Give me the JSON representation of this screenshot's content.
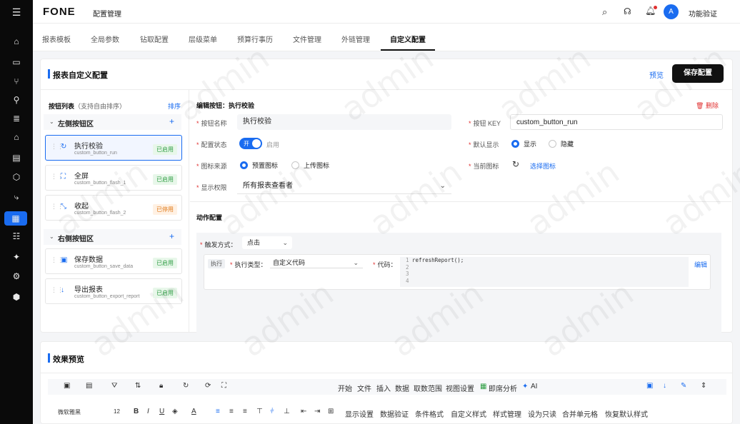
{
  "brand": {
    "logo": "FONE",
    "section": "配置管理"
  },
  "header": {
    "user_avatar": "A",
    "user_name": "功能验证"
  },
  "tabs": [
    "报表模板",
    "全局参数",
    "钻取配置",
    "层级菜单",
    "预算行事历",
    "文件管理",
    "外链管理",
    "自定义配置"
  ],
  "panel": {
    "title": "报表自定义配置",
    "preview_link": "预览",
    "save_button": "保存配置"
  },
  "button_list": {
    "title": "按钮列表",
    "hint": "（支持自由排序）",
    "sort_link": "排序",
    "groups": [
      {
        "name": "左侧按钮区",
        "add": "+",
        "items": [
          {
            "label": "执行校验",
            "key": "custom_button_run",
            "status": "已启用",
            "icon": "refresh-icon"
          },
          {
            "label": "全屏",
            "key": "custom_button_flash_1",
            "status": "已启用",
            "icon": "expand-icon"
          },
          {
            "label": "收起",
            "key": "custom_button_flash_2",
            "status": "已停用",
            "icon": "collapse-icon"
          }
        ]
      },
      {
        "name": "右侧按钮区",
        "add": "+",
        "items": [
          {
            "label": "保存数据",
            "key": "custom_button_save_data",
            "status": "已启用",
            "icon": "save-icon"
          },
          {
            "label": "导出报表",
            "key": "custom_button_export_report",
            "status": "已启用",
            "icon": "download-icon"
          }
        ]
      }
    ]
  },
  "edit": {
    "heading_prefix": "编辑按钮：",
    "heading_name": "执行校验",
    "delete_label": "删除",
    "fields": {
      "name_label": "按钮名称",
      "name_value": "执行校验",
      "key_label": "按钮 KEY",
      "key_value": "custom_button_run",
      "status_label": "配置状态",
      "switch_text": "开",
      "status_text": "启用",
      "default_label": "默认显示",
      "opt_show": "显示",
      "opt_hide": "隐藏",
      "icon_src_label": "图标来源",
      "opt_preset": "预置图标",
      "opt_upload": "上传图标",
      "current_icon_label": "当前图标",
      "choose_icon": "选择图标",
      "perm_label": "显示权限",
      "perm_value": "所有报表查看者"
    },
    "action": {
      "title": "动作配置",
      "trigger_label": "触发方式：",
      "trigger_value": "点击",
      "tag": "执行",
      "type_label": "执行类型：",
      "type_value": "自定义代码",
      "code_label": "代码：",
      "code_lines": [
        "refreshReport();",
        "",
        "",
        ""
      ],
      "line_numbers": [
        "1",
        "2",
        "3",
        "4"
      ],
      "edit_link": "编辑"
    }
  },
  "preview": {
    "title": "效果预览",
    "menu": [
      "开始",
      "文件",
      "插入",
      "数据",
      "取数范围",
      "视图设置",
      "即席分析",
      "AI"
    ],
    "font_name": "微软雅黑",
    "font_size": "12",
    "format_items": [
      "显示设置",
      "数据验证",
      "条件格式",
      "自定义样式",
      "样式管理",
      "设为只读",
      "合并单元格",
      "恢复默认样式"
    ]
  },
  "watermark": "admin",
  "colors": {
    "accent": "#1a6cf0",
    "danger": "#e03030",
    "sidebar": "#0a0a0a"
  }
}
